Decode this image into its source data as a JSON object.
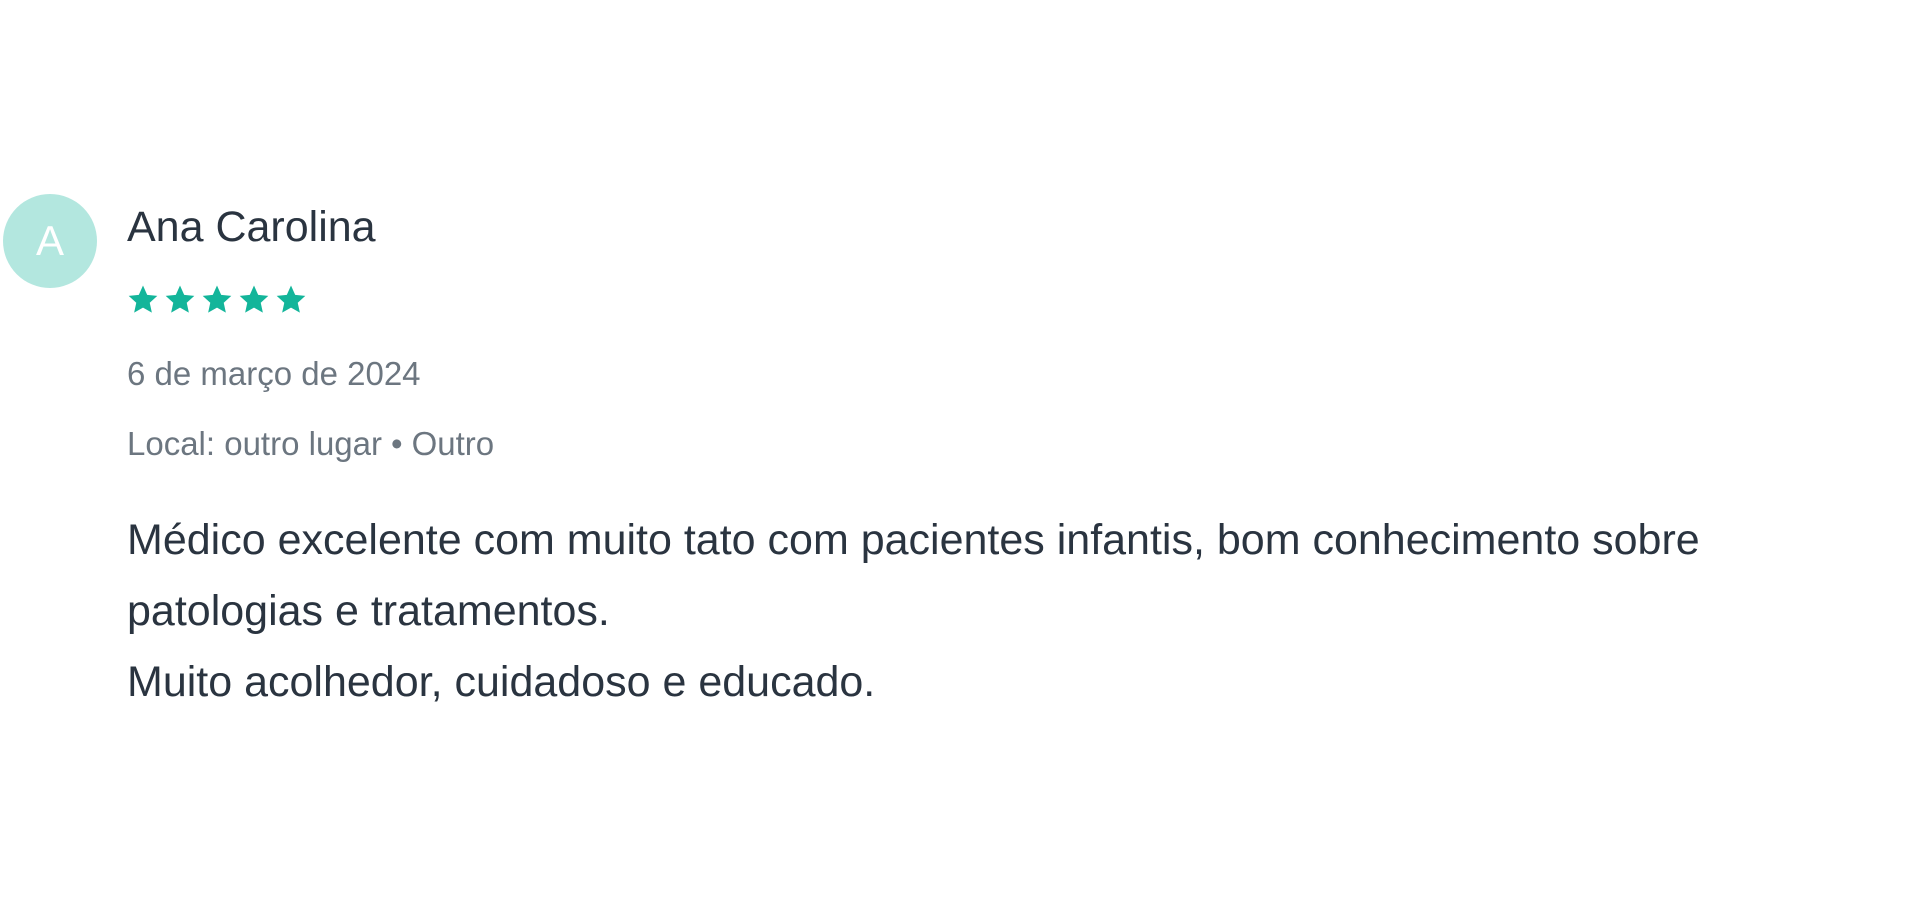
{
  "review": {
    "avatar_letter": "A",
    "author": "Ana Carolina",
    "rating": 5,
    "rating_max": 5,
    "date": "6 de março de 2024",
    "location_label": "Local: outro lugar",
    "location_separator": "•",
    "location_type": "Outro",
    "text_lines": [
      "Médico excelente com muito tato com pacientes infantis, bom conhecimento sobre patologias e tratamentos.",
      "Muito acolhedor, cuidadoso e educado."
    ]
  },
  "colors": {
    "star": "#13b59a",
    "avatar_bg": "#b3e7df",
    "text_primary": "#2a3440",
    "text_secondary": "#6c7680"
  },
  "icons": {
    "star": "star-icon"
  }
}
